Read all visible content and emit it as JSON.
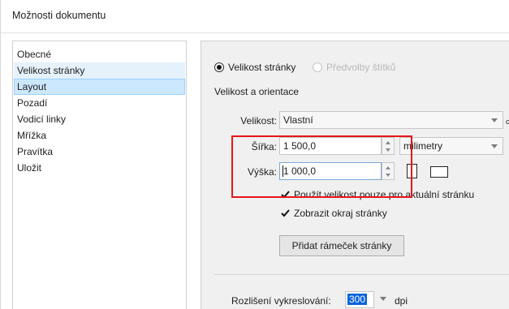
{
  "window": {
    "title": "Možnosti dokumentu"
  },
  "nav": {
    "items": [
      {
        "label": "Obecné"
      },
      {
        "label": "Velikost stránky"
      },
      {
        "label": "Layout"
      },
      {
        "label": "Pozadí"
      },
      {
        "label": "Vodicí linky"
      },
      {
        "label": "Mřížka"
      },
      {
        "label": "Pravítka"
      },
      {
        "label": "Uložit"
      }
    ],
    "hover_index": 1,
    "selected_index": 2
  },
  "page_mode": {
    "option_page_size": "Velikost stránky",
    "option_label_presets": "Předvolby štítků"
  },
  "size_section": {
    "heading": "Velikost a orientace",
    "size_label": "Velikost:",
    "size_value": "Vlastní",
    "width_label": "Šířka:",
    "width_value": "1 500,0",
    "height_label": "Výška:",
    "height_value": "1 000,0",
    "units_value": "milimetry",
    "cut_off_text": "c",
    "checkbox_current_page_only": "Použít velikost pouze pro aktuální stránku",
    "checkbox_show_border": "Zobrazit okraj stránky",
    "add_frame_button": "Přidat rámeček stránky"
  },
  "resolution": {
    "label": "Rozlišení vykreslování:",
    "value": "300",
    "unit": "dpi"
  },
  "colors": {
    "selection": "#cce8ff",
    "hover": "#e5f1fb",
    "annotation": "#e8141a"
  }
}
